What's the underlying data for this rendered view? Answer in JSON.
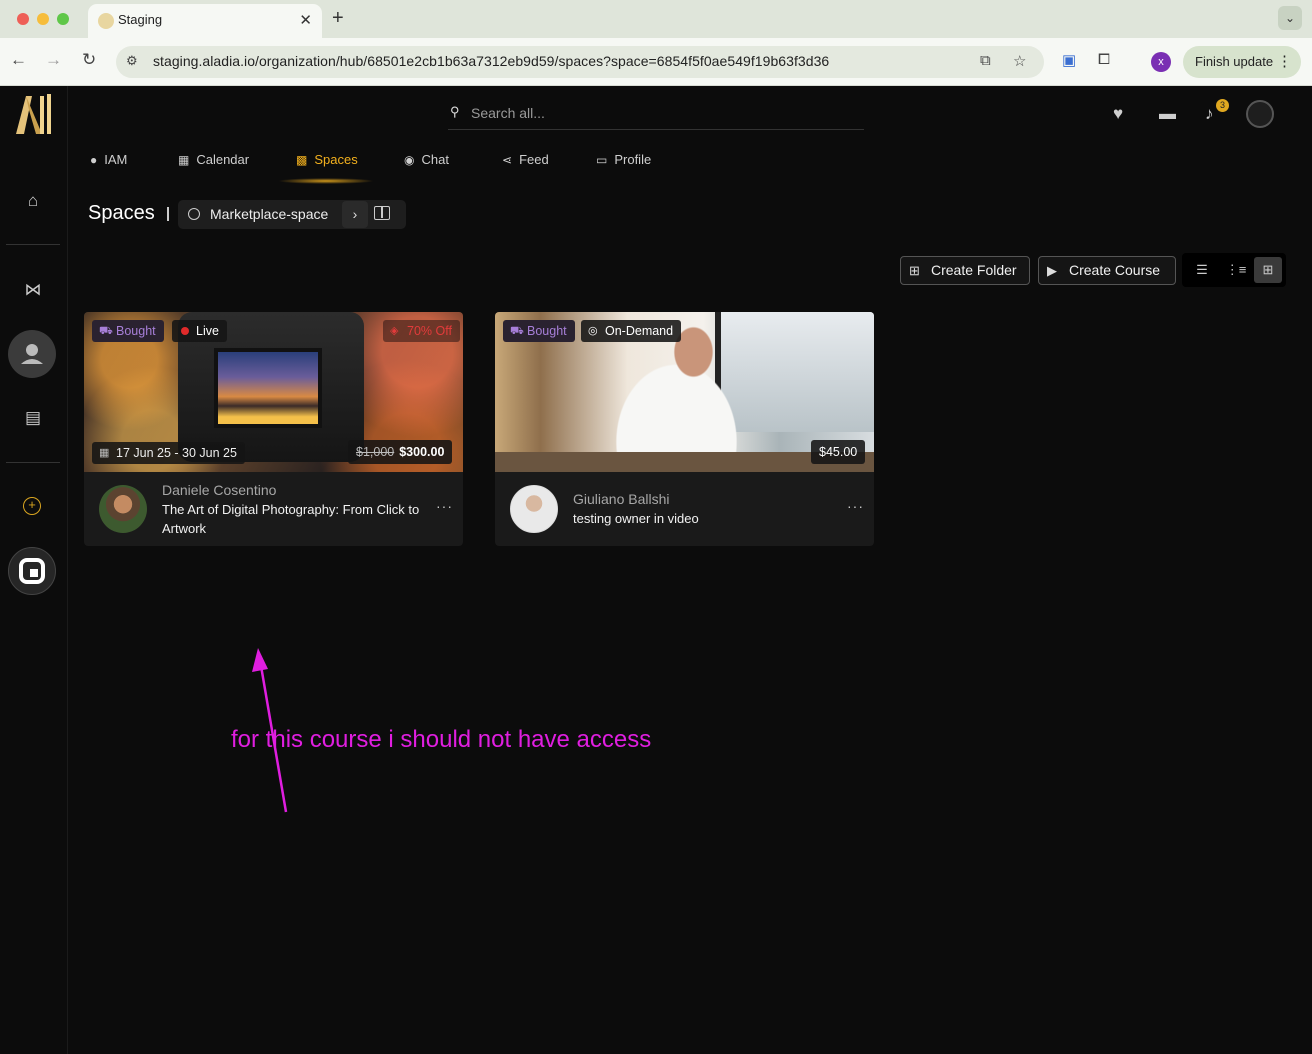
{
  "browser": {
    "tab_title": "Staging",
    "url": "staging.aladia.io/organization/hub/68501e2cb1b63a7312eb9d59/spaces?space=6854f5f0ae549f19b63f3d36",
    "profile_initial": "x",
    "finish_update_label": "Finish update"
  },
  "header": {
    "search_placeholder": "Search all...",
    "notification_count": "3"
  },
  "nav": {
    "items": [
      {
        "label": "IAM",
        "icon": "user-icon"
      },
      {
        "label": "Calendar",
        "icon": "calendar-icon"
      },
      {
        "label": "Spaces",
        "icon": "spaces-icon",
        "active": true
      },
      {
        "label": "Chat",
        "icon": "chat-icon"
      },
      {
        "label": "Feed",
        "icon": "share-icon"
      },
      {
        "label": "Profile",
        "icon": "id-card-icon"
      }
    ]
  },
  "page": {
    "title": "Spaces",
    "breadcrumb": "Marketplace-space",
    "create_folder_label": "Create Folder",
    "create_course_label": "Create Course"
  },
  "cards": [
    {
      "badges": [
        "Bought",
        "Live",
        "70% Off"
      ],
      "date_range": "17 Jun 25 - 30 Jun 25",
      "price_old": "$1,000",
      "price_new": "$300.00",
      "owner": "Daniele Cosentino",
      "title": "The Art of Digital Photography: From Click to Artwork"
    },
    {
      "badges": [
        "Bought",
        "On-Demand"
      ],
      "price_new": "$45.00",
      "owner": "Giuliano Ballshi",
      "title": "testing owner in video"
    }
  ],
  "annotation": {
    "text": "for this course i should not have access",
    "color": "#e01ee0"
  },
  "colors": {
    "accent": "#f2b01e",
    "bought": "#a77fd8",
    "live": "#e02a2a"
  }
}
